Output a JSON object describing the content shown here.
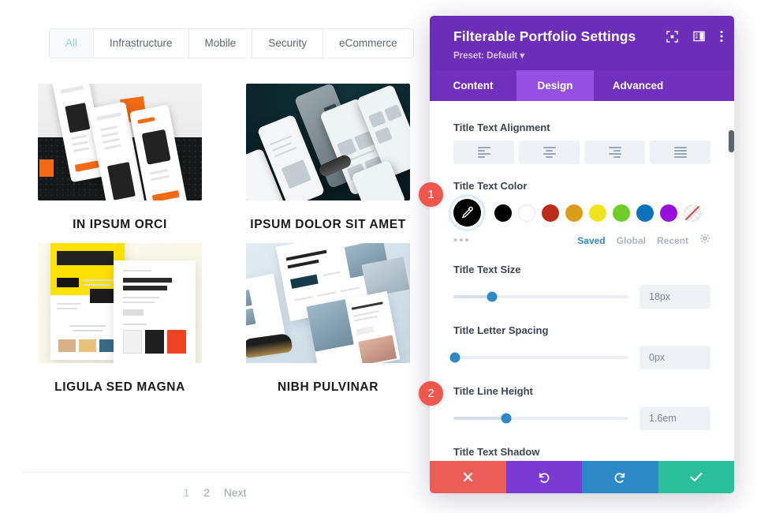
{
  "portfolio": {
    "filters": [
      {
        "label": "All",
        "active": true
      },
      {
        "label": "Infrastructure",
        "active": false
      },
      {
        "label": "Mobile",
        "active": false
      },
      {
        "label": "Security",
        "active": false
      },
      {
        "label": "eCommerce",
        "active": false
      }
    ],
    "items": [
      {
        "title": "IN IPSUM ORCI"
      },
      {
        "title": "IPSUM DOLOR SIT AMET"
      },
      {
        "title": "LIGULA SED MAGNA"
      },
      {
        "title": "NIBH PULVINAR"
      }
    ],
    "pagination": {
      "page1": "1",
      "page2": "2",
      "next": "Next",
      "current": "1"
    }
  },
  "modal": {
    "title": "Filterable Portfolio Settings",
    "preset": "Preset: Default",
    "header_icons": [
      "focus-icon",
      "layout-icon",
      "more-options-icon"
    ],
    "tabs": [
      {
        "label": "Content",
        "active": false
      },
      {
        "label": "Design",
        "active": true
      },
      {
        "label": "Advanced",
        "active": false
      }
    ],
    "sections": {
      "alignment": {
        "label": "Title Text Alignment",
        "options": [
          "align-left",
          "align-center",
          "align-right",
          "align-justify"
        ]
      },
      "color": {
        "label": "Title Text Color",
        "selected": "#000000",
        "eyedropper_icon": "eyedropper-icon",
        "swatches": [
          "#000000",
          "#ffffff",
          "#bb2b19",
          "#dc9b16",
          "#f0e320",
          "#6ecd26",
          "#0b73bc",
          "#9a0fdb",
          "transparent"
        ],
        "more_label": "•••",
        "links": [
          {
            "label": "Saved",
            "active": true
          },
          {
            "label": "Global",
            "active": false
          },
          {
            "label": "Recent",
            "active": false
          }
        ],
        "settings_icon": "gear-icon"
      },
      "text_size": {
        "label": "Title Text Size",
        "value": "18px",
        "fill": "22%"
      },
      "letter_spacing": {
        "label": "Title Letter Spacing",
        "value": "0px",
        "fill": "1%"
      },
      "line_height": {
        "label": "Title Line Height",
        "value": "1.6em",
        "fill": "30%"
      },
      "text_shadow": {
        "label": "Title Text Shadow"
      }
    },
    "footer": {
      "cancel": "✖",
      "undo": "↺",
      "redo": "↻",
      "save": "✔"
    }
  },
  "badges": [
    {
      "number": "1"
    },
    {
      "number": "2"
    }
  ],
  "colors": {
    "brand_purple": "#6c2eb9",
    "tab_active": "#9450e2",
    "accent_blue": "#2d8ac7",
    "badge_red": "#f0564c",
    "save_green": "#2bbf9b"
  }
}
